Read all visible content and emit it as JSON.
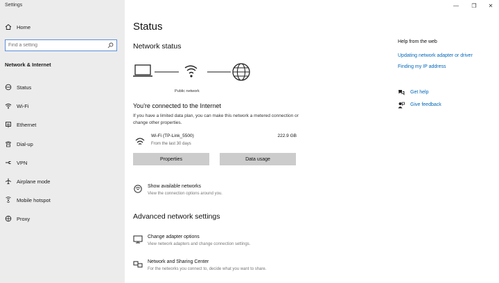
{
  "window": {
    "title": "Settings",
    "controls": {
      "minimize": "—",
      "maximize": "❐",
      "close": "✕"
    }
  },
  "sidebar": {
    "home_label": "Home",
    "search_placeholder": "Find a setting",
    "section_label": "Network & Internet",
    "items": [
      {
        "label": "Status",
        "icon": "home-status-icon"
      },
      {
        "label": "Wi-Fi",
        "icon": "wifi-icon"
      },
      {
        "label": "Ethernet",
        "icon": "ethernet-icon"
      },
      {
        "label": "Dial-up",
        "icon": "dialup-icon"
      },
      {
        "label": "VPN",
        "icon": "vpn-icon"
      },
      {
        "label": "Airplane mode",
        "icon": "airplane-icon"
      },
      {
        "label": "Mobile hotspot",
        "icon": "hotspot-icon"
      },
      {
        "label": "Proxy",
        "icon": "globe-icon"
      }
    ]
  },
  "main": {
    "title": "Status",
    "network_status_heading": "Network status",
    "network_caption": "Public network",
    "connected_heading": "You're connected to the Internet",
    "connected_desc": "If you have a limited data plan, you can make this network a metered connection or change other properties.",
    "connection": {
      "name": "Wi-Fi (TP-Link_5500)",
      "sub": "From the last 30 days",
      "usage": "222.9 GB"
    },
    "buttons": {
      "properties": "Properties",
      "data_usage": "Data usage"
    },
    "show_networks": {
      "title": "Show available networks",
      "sub": "View the connection options around you."
    },
    "advanced_heading": "Advanced network settings",
    "advanced": [
      {
        "title": "Change adapter options",
        "sub": "View network adapters and change connection settings."
      },
      {
        "title": "Network and Sharing Center",
        "sub": "For the networks you connect to, decide what you want to share."
      }
    ]
  },
  "help": {
    "title": "Help from the web",
    "links": [
      "Updating network adapter or driver",
      "Finding my IP address"
    ],
    "get_help": "Get help",
    "give_feedback": "Give feedback"
  }
}
